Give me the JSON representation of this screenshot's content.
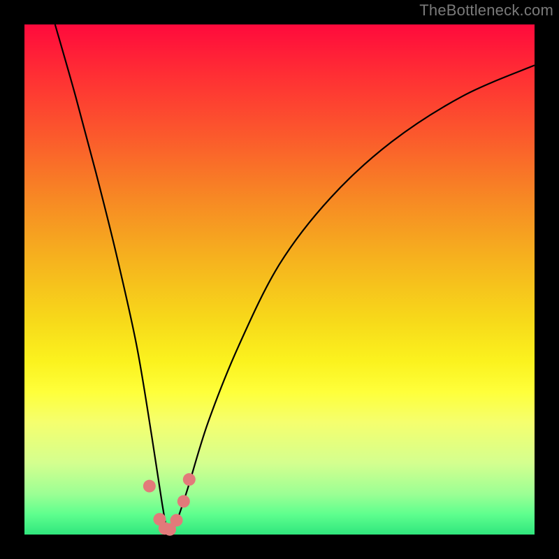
{
  "attribution": "TheBottleneck.com",
  "chart_data": {
    "type": "line",
    "title": "",
    "xlabel": "",
    "ylabel": "",
    "xlim": [
      0,
      100
    ],
    "ylim": [
      0,
      100
    ],
    "background_gradient": {
      "top_color": "#ff0a3c",
      "mid_colors": [
        "#f78824",
        "#f7d91a",
        "#feff3a"
      ],
      "bottom_color": "#30e67d",
      "meaning": "red-high-to-green-low vertical heat gradient"
    },
    "series": [
      {
        "name": "primary-curve",
        "description": "V-shaped curve: steep descending left arm, narrow bottom near x≈28, rising right arm flattening out",
        "x": [
          6,
          10,
          14,
          18,
          22,
          25,
          27,
          28,
          29,
          30,
          32,
          36,
          42,
          50,
          60,
          72,
          86,
          100
        ],
        "y": [
          100,
          86,
          71,
          55,
          37,
          19,
          6,
          1,
          1,
          3,
          9,
          22,
          37,
          53,
          66,
          77,
          86,
          92
        ]
      }
    ],
    "highlight_points": {
      "name": "valley-cluster",
      "color": "#e27a7a",
      "points": [
        {
          "x": 24.5,
          "y": 9.5
        },
        {
          "x": 26.5,
          "y": 3.0
        },
        {
          "x": 27.5,
          "y": 1.2
        },
        {
          "x": 28.5,
          "y": 1.0
        },
        {
          "x": 29.8,
          "y": 2.8
        },
        {
          "x": 31.2,
          "y": 6.5
        },
        {
          "x": 32.3,
          "y": 10.8
        }
      ]
    }
  }
}
